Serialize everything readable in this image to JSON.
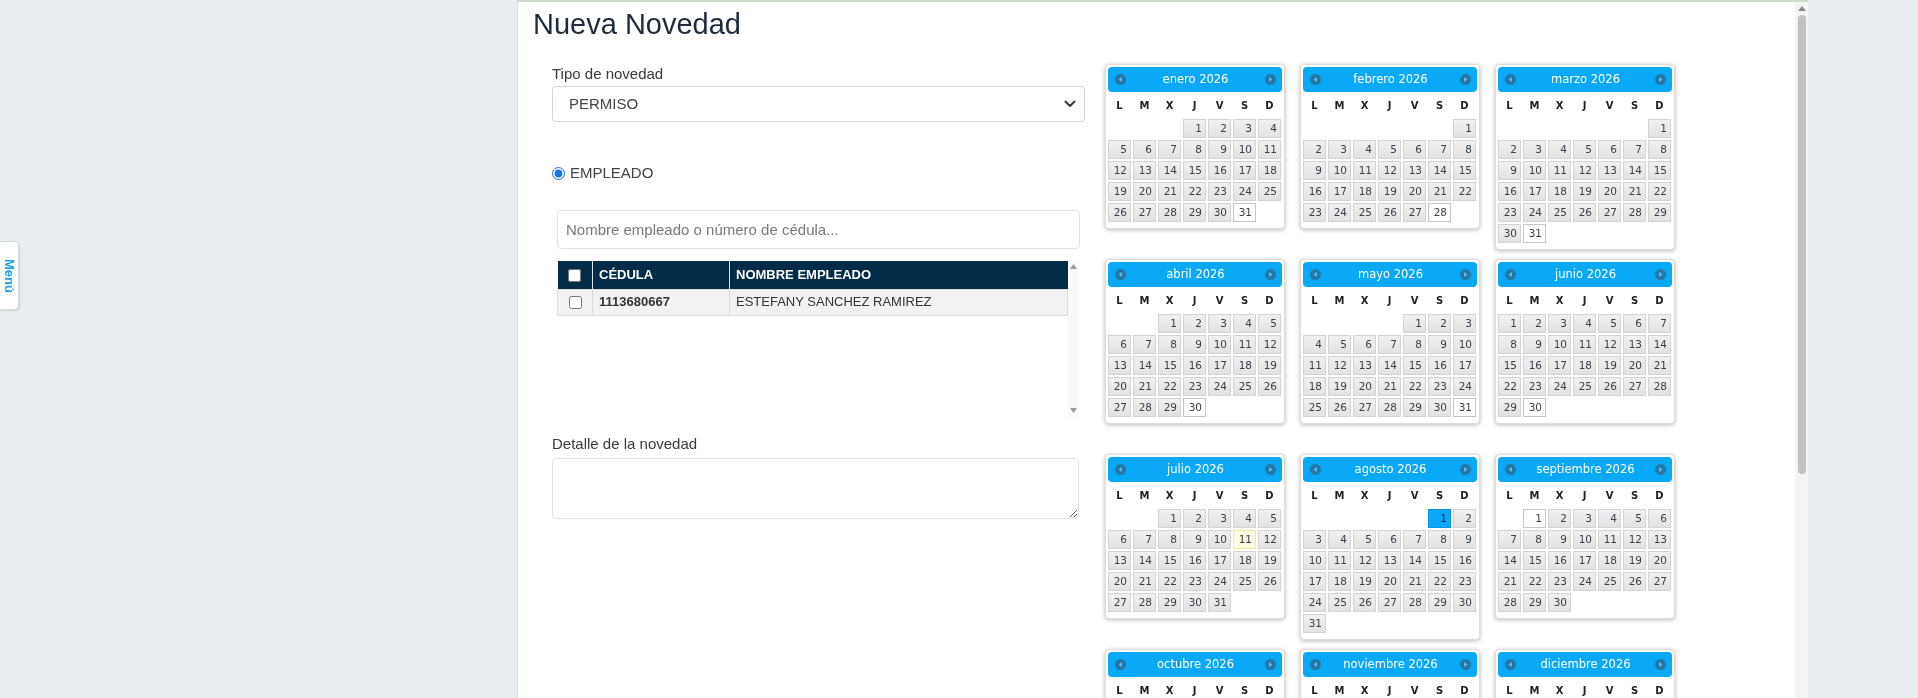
{
  "menu_tab": {
    "label": "Menú"
  },
  "title": "Nueva Novedad",
  "form": {
    "type_field": {
      "label": "Tipo de novedad",
      "value": "PERMISO"
    },
    "target_options": [
      {
        "label": "EMPLEADO",
        "selected": true
      }
    ],
    "search": {
      "placeholder": "Nombre empleado o número de cédula..."
    },
    "employee_table": {
      "select_all_checked": false,
      "columns": [
        "CÉDULA",
        "NOMBRE EMPLEADO"
      ],
      "rows": [
        {
          "checked": false,
          "cells": [
            "1113680667",
            "ESTEFANY SANCHEZ RAMIREZ"
          ]
        }
      ]
    },
    "detail_field": {
      "label": "Detalle de la novedad"
    }
  },
  "calendar": {
    "months": [
      {
        "title": "enero 2026",
        "weekdays": [
          "L",
          "M",
          "X",
          "J",
          "V",
          "S",
          "D"
        ],
        "weeks": [
          [
            {
              "day": "1",
              "selected": false,
              "kind": "plain"
            },
            {
              "day": "2",
              "selected": false,
              "kind": "plain"
            },
            {
              "day": "3",
              "selected": false,
              "kind": "plain"
            },
            {
              "day": "4",
              "selected": false,
              "kind": "plain"
            }
          ],
          [
            {
              "day": "5",
              "selected": false,
              "kind": "plain"
            },
            {
              "day": "6",
              "selected": false,
              "kind": "plain"
            },
            {
              "day": "7",
              "selected": false,
              "kind": "plain"
            },
            {
              "day": "8",
              "selected": false,
              "kind": "plain"
            },
            {
              "day": "9",
              "selected": false,
              "kind": "plain"
            },
            {
              "day": "10",
              "selected": false,
              "kind": "plain"
            },
            {
              "day": "11",
              "selected": false,
              "kind": "plain"
            }
          ],
          [
            {
              "day": "12",
              "selected": false,
              "kind": "plain"
            },
            {
              "day": "13",
              "selected": false,
              "kind": "plain"
            },
            {
              "day": "14",
              "selected": false,
              "kind": "plain"
            },
            {
              "day": "15",
              "selected": false,
              "kind": "plain"
            },
            {
              "day": "16",
              "selected": false,
              "kind": "plain"
            },
            {
              "day": "17",
              "selected": false,
              "kind": "plain"
            },
            {
              "day": "18",
              "selected": false,
              "kind": "plain"
            }
          ],
          [
            {
              "day": "19",
              "selected": false,
              "kind": "plain"
            },
            {
              "day": "20",
              "selected": false,
              "kind": "plain"
            },
            {
              "day": "21",
              "selected": false,
              "kind": "plain"
            },
            {
              "day": "22",
              "selected": false,
              "kind": "plain"
            },
            {
              "day": "23",
              "selected": false,
              "kind": "plain"
            },
            {
              "day": "24",
              "selected": false,
              "kind": "plain"
            },
            {
              "day": "25",
              "selected": false,
              "kind": "plain"
            }
          ],
          [
            {
              "day": "26",
              "selected": false,
              "kind": "plain"
            },
            {
              "day": "27",
              "selected": false,
              "kind": "plain"
            },
            {
              "day": "28",
              "selected": false,
              "kind": "plain"
            },
            {
              "day": "29",
              "selected": false,
              "kind": "plain"
            },
            {
              "day": "30",
              "selected": false,
              "kind": "plain"
            },
            {
              "day": "31",
              "selected": false,
              "kind": "outlined"
            }
          ]
        ]
      },
      {
        "title": "febrero 2026",
        "weekdays": [
          "L",
          "M",
          "X",
          "J",
          "V",
          "S",
          "D"
        ],
        "weeks": [
          [
            {
              "day": "1",
              "selected": false,
              "kind": "plain"
            }
          ],
          [
            {
              "day": "2",
              "selected": false,
              "kind": "plain"
            },
            {
              "day": "3",
              "selected": false,
              "kind": "plain"
            },
            {
              "day": "4",
              "selected": false,
              "kind": "plain"
            },
            {
              "day": "5",
              "selected": false,
              "kind": "plain"
            },
            {
              "day": "6",
              "selected": false,
              "kind": "plain"
            },
            {
              "day": "7",
              "selected": false,
              "kind": "plain"
            },
            {
              "day": "8",
              "selected": false,
              "kind": "plain"
            }
          ],
          [
            {
              "day": "9",
              "selected": false,
              "kind": "plain"
            },
            {
              "day": "10",
              "selected": false,
              "kind": "plain"
            },
            {
              "day": "11",
              "selected": false,
              "kind": "plain"
            },
            {
              "day": "12",
              "selected": false,
              "kind": "plain"
            },
            {
              "day": "13",
              "selected": false,
              "kind": "plain"
            },
            {
              "day": "14",
              "selected": false,
              "kind": "plain"
            },
            {
              "day": "15",
              "selected": false,
              "kind": "plain"
            }
          ],
          [
            {
              "day": "16",
              "selected": false,
              "kind": "plain"
            },
            {
              "day": "17",
              "selected": false,
              "kind": "plain"
            },
            {
              "day": "18",
              "selected": false,
              "kind": "plain"
            },
            {
              "day": "19",
              "selected": false,
              "kind": "plain"
            },
            {
              "day": "20",
              "selected": false,
              "kind": "plain"
            },
            {
              "day": "21",
              "selected": false,
              "kind": "plain"
            },
            {
              "day": "22",
              "selected": false,
              "kind": "plain"
            }
          ],
          [
            {
              "day": "23",
              "selected": false,
              "kind": "plain"
            },
            {
              "day": "24",
              "selected": false,
              "kind": "plain"
            },
            {
              "day": "25",
              "selected": false,
              "kind": "plain"
            },
            {
              "day": "26",
              "selected": false,
              "kind": "plain"
            },
            {
              "day": "27",
              "selected": false,
              "kind": "plain"
            },
            {
              "day": "28",
              "selected": false,
              "kind": "outlined"
            }
          ]
        ]
      },
      {
        "title": "marzo 2026",
        "weekdays": [
          "L",
          "M",
          "X",
          "J",
          "V",
          "S",
          "D"
        ],
        "weeks": [
          [
            {
              "day": "1",
              "selected": false,
              "kind": "plain"
            }
          ],
          [
            {
              "day": "2",
              "selected": false,
              "kind": "plain"
            },
            {
              "day": "3",
              "selected": false,
              "kind": "plain"
            },
            {
              "day": "4",
              "selected": false,
              "kind": "plain"
            },
            {
              "day": "5",
              "selected": false,
              "kind": "plain"
            },
            {
              "day": "6",
              "selected": false,
              "kind": "plain"
            },
            {
              "day": "7",
              "selected": false,
              "kind": "plain"
            },
            {
              "day": "8",
              "selected": false,
              "kind": "plain"
            }
          ],
          [
            {
              "day": "9",
              "selected": false,
              "kind": "plain"
            },
            {
              "day": "10",
              "selected": false,
              "kind": "plain"
            },
            {
              "day": "11",
              "selected": false,
              "kind": "plain"
            },
            {
              "day": "12",
              "selected": false,
              "kind": "plain"
            },
            {
              "day": "13",
              "selected": false,
              "kind": "plain"
            },
            {
              "day": "14",
              "selected": false,
              "kind": "plain"
            },
            {
              "day": "15",
              "selected": false,
              "kind": "plain"
            }
          ],
          [
            {
              "day": "16",
              "selected": false,
              "kind": "plain"
            },
            {
              "day": "17",
              "selected": false,
              "kind": "plain"
            },
            {
              "day": "18",
              "selected": false,
              "kind": "plain"
            },
            {
              "day": "19",
              "selected": false,
              "kind": "plain"
            },
            {
              "day": "20",
              "selected": false,
              "kind": "plain"
            },
            {
              "day": "21",
              "selected": false,
              "kind": "plain"
            },
            {
              "day": "22",
              "selected": false,
              "kind": "plain"
            }
          ],
          [
            {
              "day": "23",
              "selected": false,
              "kind": "plain"
            },
            {
              "day": "24",
              "selected": false,
              "kind": "plain"
            },
            {
              "day": "25",
              "selected": false,
              "kind": "plain"
            },
            {
              "day": "26",
              "selected": false,
              "kind": "plain"
            },
            {
              "day": "27",
              "selected": false,
              "kind": "plain"
            },
            {
              "day": "28",
              "selected": false,
              "kind": "plain"
            },
            {
              "day": "29",
              "selected": false,
              "kind": "plain"
            }
          ],
          [
            {
              "day": "30",
              "selected": false,
              "kind": "plain"
            },
            {
              "day": "31",
              "selected": false,
              "kind": "outlined"
            }
          ]
        ]
      },
      {
        "title": "abril 2026",
        "weekdays": [
          "L",
          "M",
          "X",
          "J",
          "V",
          "S",
          "D"
        ],
        "weeks": [
          [
            {
              "day": "1",
              "selected": false,
              "kind": "plain"
            },
            {
              "day": "2",
              "selected": false,
              "kind": "plain"
            },
            {
              "day": "3",
              "selected": false,
              "kind": "plain"
            },
            {
              "day": "4",
              "selected": false,
              "kind": "plain"
            },
            {
              "day": "5",
              "selected": false,
              "kind": "plain"
            }
          ],
          [
            {
              "day": "6",
              "selected": false,
              "kind": "plain"
            },
            {
              "day": "7",
              "selected": false,
              "kind": "plain"
            },
            {
              "day": "8",
              "selected": false,
              "kind": "plain"
            },
            {
              "day": "9",
              "selected": false,
              "kind": "plain"
            },
            {
              "day": "10",
              "selected": false,
              "kind": "plain"
            },
            {
              "day": "11",
              "selected": false,
              "kind": "plain"
            },
            {
              "day": "12",
              "selected": false,
              "kind": "plain"
            }
          ],
          [
            {
              "day": "13",
              "selected": false,
              "kind": "plain"
            },
            {
              "day": "14",
              "selected": false,
              "kind": "plain"
            },
            {
              "day": "15",
              "selected": false,
              "kind": "plain"
            },
            {
              "day": "16",
              "selected": false,
              "kind": "plain"
            },
            {
              "day": "17",
              "selected": false,
              "kind": "plain"
            },
            {
              "day": "18",
              "selected": false,
              "kind": "plain"
            },
            {
              "day": "19",
              "selected": false,
              "kind": "plain"
            }
          ],
          [
            {
              "day": "20",
              "selected": false,
              "kind": "plain"
            },
            {
              "day": "21",
              "selected": false,
              "kind": "plain"
            },
            {
              "day": "22",
              "selected": false,
              "kind": "plain"
            },
            {
              "day": "23",
              "selected": false,
              "kind": "plain"
            },
            {
              "day": "24",
              "selected": false,
              "kind": "plain"
            },
            {
              "day": "25",
              "selected": false,
              "kind": "plain"
            },
            {
              "day": "26",
              "selected": false,
              "kind": "plain"
            }
          ],
          [
            {
              "day": "27",
              "selected": false,
              "kind": "plain"
            },
            {
              "day": "28",
              "selected": false,
              "kind": "plain"
            },
            {
              "day": "29",
              "selected": false,
              "kind": "plain"
            },
            {
              "day": "30",
              "selected": false,
              "kind": "outlined"
            }
          ]
        ]
      },
      {
        "title": "mayo 2026",
        "weekdays": [
          "L",
          "M",
          "X",
          "J",
          "V",
          "S",
          "D"
        ],
        "weeks": [
          [
            {
              "day": "1",
              "selected": false,
              "kind": "plain"
            },
            {
              "day": "2",
              "selected": false,
              "kind": "plain"
            },
            {
              "day": "3",
              "selected": false,
              "kind": "plain"
            }
          ],
          [
            {
              "day": "4",
              "selected": false,
              "kind": "plain"
            },
            {
              "day": "5",
              "selected": false,
              "kind": "plain"
            },
            {
              "day": "6",
              "selected": false,
              "kind": "plain"
            },
            {
              "day": "7",
              "selected": false,
              "kind": "plain"
            },
            {
              "day": "8",
              "selected": false,
              "kind": "plain"
            },
            {
              "day": "9",
              "selected": false,
              "kind": "plain"
            },
            {
              "day": "10",
              "selected": false,
              "kind": "plain"
            }
          ],
          [
            {
              "day": "11",
              "selected": false,
              "kind": "plain"
            },
            {
              "day": "12",
              "selected": false,
              "kind": "plain"
            },
            {
              "day": "13",
              "selected": false,
              "kind": "plain"
            },
            {
              "day": "14",
              "selected": false,
              "kind": "plain"
            },
            {
              "day": "15",
              "selected": false,
              "kind": "plain"
            },
            {
              "day": "16",
              "selected": false,
              "kind": "plain"
            },
            {
              "day": "17",
              "selected": false,
              "kind": "plain"
            }
          ],
          [
            {
              "day": "18",
              "selected": false,
              "kind": "plain"
            },
            {
              "day": "19",
              "selected": false,
              "kind": "plain"
            },
            {
              "day": "20",
              "selected": false,
              "kind": "plain"
            },
            {
              "day": "21",
              "selected": false,
              "kind": "plain"
            },
            {
              "day": "22",
              "selected": false,
              "kind": "plain"
            },
            {
              "day": "23",
              "selected": false,
              "kind": "plain"
            },
            {
              "day": "24",
              "selected": false,
              "kind": "plain"
            }
          ],
          [
            {
              "day": "25",
              "selected": false,
              "kind": "plain"
            },
            {
              "day": "26",
              "selected": false,
              "kind": "plain"
            },
            {
              "day": "27",
              "selected": false,
              "kind": "plain"
            },
            {
              "day": "28",
              "selected": false,
              "kind": "plain"
            },
            {
              "day": "29",
              "selected": false,
              "kind": "plain"
            },
            {
              "day": "30",
              "selected": false,
              "kind": "plain"
            },
            {
              "day": "31",
              "selected": false,
              "kind": "outlined"
            }
          ]
        ]
      },
      {
        "title": "junio 2026",
        "weekdays": [
          "L",
          "M",
          "X",
          "J",
          "V",
          "S",
          "D"
        ],
        "weeks": [
          [
            {
              "day": "1",
              "selected": false,
              "kind": "plain"
            },
            {
              "day": "2",
              "selected": false,
              "kind": "plain"
            },
            {
              "day": "3",
              "selected": false,
              "kind": "plain"
            },
            {
              "day": "4",
              "selected": false,
              "kind": "plain"
            },
            {
              "day": "5",
              "selected": false,
              "kind": "plain"
            },
            {
              "day": "6",
              "selected": false,
              "kind": "plain"
            },
            {
              "day": "7",
              "selected": false,
              "kind": "plain"
            }
          ],
          [
            {
              "day": "8",
              "selected": false,
              "kind": "plain"
            },
            {
              "day": "9",
              "selected": false,
              "kind": "plain"
            },
            {
              "day": "10",
              "selected": false,
              "kind": "plain"
            },
            {
              "day": "11",
              "selected": false,
              "kind": "plain"
            },
            {
              "day": "12",
              "selected": false,
              "kind": "plain"
            },
            {
              "day": "13",
              "selected": false,
              "kind": "plain"
            },
            {
              "day": "14",
              "selected": false,
              "kind": "plain"
            }
          ],
          [
            {
              "day": "15",
              "selected": false,
              "kind": "plain"
            },
            {
              "day": "16",
              "selected": false,
              "kind": "plain"
            },
            {
              "day": "17",
              "selected": false,
              "kind": "plain"
            },
            {
              "day": "18",
              "selected": false,
              "kind": "plain"
            },
            {
              "day": "19",
              "selected": false,
              "kind": "plain"
            },
            {
              "day": "20",
              "selected": false,
              "kind": "plain"
            },
            {
              "day": "21",
              "selected": false,
              "kind": "plain"
            }
          ],
          [
            {
              "day": "22",
              "selected": false,
              "kind": "plain"
            },
            {
              "day": "23",
              "selected": false,
              "kind": "plain"
            },
            {
              "day": "24",
              "selected": false,
              "kind": "plain"
            },
            {
              "day": "25",
              "selected": false,
              "kind": "plain"
            },
            {
              "day": "26",
              "selected": false,
              "kind": "plain"
            },
            {
              "day": "27",
              "selected": false,
              "kind": "plain"
            },
            {
              "day": "28",
              "selected": false,
              "kind": "plain"
            }
          ],
          [
            {
              "day": "29",
              "selected": false,
              "kind": "plain"
            },
            {
              "day": "30",
              "selected": false,
              "kind": "outlined"
            }
          ]
        ]
      },
      {
        "title": "julio 2026",
        "weekdays": [
          "L",
          "M",
          "X",
          "J",
          "V",
          "S",
          "D"
        ],
        "weeks": [
          [
            {
              "day": "1",
              "selected": false,
              "kind": "plain"
            },
            {
              "day": "2",
              "selected": false,
              "kind": "plain"
            },
            {
              "day": "3",
              "selected": false,
              "kind": "plain"
            },
            {
              "day": "4",
              "selected": false,
              "kind": "plain"
            },
            {
              "day": "5",
              "selected": false,
              "kind": "plain"
            }
          ],
          [
            {
              "day": "6",
              "selected": false,
              "kind": "plain"
            },
            {
              "day": "7",
              "selected": false,
              "kind": "plain"
            },
            {
              "day": "8",
              "selected": false,
              "kind": "plain"
            },
            {
              "day": "9",
              "selected": false,
              "kind": "plain"
            },
            {
              "day": "10",
              "selected": false,
              "kind": "plain"
            },
            {
              "day": "11",
              "selected": false,
              "kind": "today"
            },
            {
              "day": "12",
              "selected": false,
              "kind": "plain"
            }
          ],
          [
            {
              "day": "13",
              "selected": false,
              "kind": "plain"
            },
            {
              "day": "14",
              "selected": false,
              "kind": "plain"
            },
            {
              "day": "15",
              "selected": false,
              "kind": "plain"
            },
            {
              "day": "16",
              "selected": false,
              "kind": "plain"
            },
            {
              "day": "17",
              "selected": false,
              "kind": "plain"
            },
            {
              "day": "18",
              "selected": false,
              "kind": "plain"
            },
            {
              "day": "19",
              "selected": false,
              "kind": "plain"
            }
          ],
          [
            {
              "day": "20",
              "selected": false,
              "kind": "plain"
            },
            {
              "day": "21",
              "selected": false,
              "kind": "plain"
            },
            {
              "day": "22",
              "selected": false,
              "kind": "plain"
            },
            {
              "day": "23",
              "selected": false,
              "kind": "plain"
            },
            {
              "day": "24",
              "selected": false,
              "kind": "plain"
            },
            {
              "day": "25",
              "selected": false,
              "kind": "plain"
            },
            {
              "day": "26",
              "selected": false,
              "kind": "plain"
            }
          ],
          [
            {
              "day": "27",
              "selected": false,
              "kind": "plain"
            },
            {
              "day": "28",
              "selected": false,
              "kind": "plain"
            },
            {
              "day": "29",
              "selected": false,
              "kind": "plain"
            },
            {
              "day": "30",
              "selected": false,
              "kind": "plain"
            },
            {
              "day": "31",
              "selected": false,
              "kind": "plain"
            }
          ]
        ]
      },
      {
        "title": "agosto 2026",
        "weekdays": [
          "L",
          "M",
          "X",
          "J",
          "V",
          "S",
          "D"
        ],
        "weeks": [
          [
            {
              "day": "1",
              "selected": true,
              "kind": "plain"
            },
            {
              "day": "2",
              "selected": false,
              "kind": "plain"
            }
          ],
          [
            {
              "day": "3",
              "selected": false,
              "kind": "plain"
            },
            {
              "day": "4",
              "selected": false,
              "kind": "plain"
            },
            {
              "day": "5",
              "selected": false,
              "kind": "plain"
            },
            {
              "day": "6",
              "selected": false,
              "kind": "plain"
            },
            {
              "day": "7",
              "selected": false,
              "kind": "plain"
            },
            {
              "day": "8",
              "selected": false,
              "kind": "plain"
            },
            {
              "day": "9",
              "selected": false,
              "kind": "plain"
            }
          ],
          [
            {
              "day": "10",
              "selected": false,
              "kind": "plain"
            },
            {
              "day": "11",
              "selected": false,
              "kind": "plain"
            },
            {
              "day": "12",
              "selected": false,
              "kind": "plain"
            },
            {
              "day": "13",
              "selected": false,
              "kind": "plain"
            },
            {
              "day": "14",
              "selected": false,
              "kind": "plain"
            },
            {
              "day": "15",
              "selected": false,
              "kind": "plain"
            },
            {
              "day": "16",
              "selected": false,
              "kind": "plain"
            }
          ],
          [
            {
              "day": "17",
              "selected": false,
              "kind": "plain"
            },
            {
              "day": "18",
              "selected": false,
              "kind": "plain"
            },
            {
              "day": "19",
              "selected": false,
              "kind": "plain"
            },
            {
              "day": "20",
              "selected": false,
              "kind": "plain"
            },
            {
              "day": "21",
              "selected": false,
              "kind": "plain"
            },
            {
              "day": "22",
              "selected": false,
              "kind": "plain"
            },
            {
              "day": "23",
              "selected": false,
              "kind": "plain"
            }
          ],
          [
            {
              "day": "24",
              "selected": false,
              "kind": "plain"
            },
            {
              "day": "25",
              "selected": false,
              "kind": "plain"
            },
            {
              "day": "26",
              "selected": false,
              "kind": "plain"
            },
            {
              "day": "27",
              "selected": false,
              "kind": "plain"
            },
            {
              "day": "28",
              "selected": false,
              "kind": "plain"
            },
            {
              "day": "29",
              "selected": false,
              "kind": "plain"
            },
            {
              "day": "30",
              "selected": false,
              "kind": "plain"
            }
          ],
          [
            {
              "day": "31",
              "selected": false,
              "kind": "plain"
            }
          ]
        ]
      },
      {
        "title": "septiembre 2026",
        "weekdays": [
          "L",
          "M",
          "X",
          "J",
          "V",
          "S",
          "D"
        ],
        "weeks": [
          [
            {
              "day": "1",
              "selected": false,
              "kind": "outlined"
            },
            {
              "day": "2",
              "selected": false,
              "kind": "plain"
            },
            {
              "day": "3",
              "selected": false,
              "kind": "plain"
            },
            {
              "day": "4",
              "selected": false,
              "kind": "plain"
            },
            {
              "day": "5",
              "selected": false,
              "kind": "plain"
            },
            {
              "day": "6",
              "selected": false,
              "kind": "plain"
            }
          ],
          [
            {
              "day": "7",
              "selected": false,
              "kind": "plain"
            },
            {
              "day": "8",
              "selected": false,
              "kind": "plain"
            },
            {
              "day": "9",
              "selected": false,
              "kind": "plain"
            },
            {
              "day": "10",
              "selected": false,
              "kind": "plain"
            },
            {
              "day": "11",
              "selected": false,
              "kind": "plain"
            },
            {
              "day": "12",
              "selected": false,
              "kind": "plain"
            },
            {
              "day": "13",
              "selected": false,
              "kind": "plain"
            }
          ],
          [
            {
              "day": "14",
              "selected": false,
              "kind": "plain"
            },
            {
              "day": "15",
              "selected": false,
              "kind": "plain"
            },
            {
              "day": "16",
              "selected": false,
              "kind": "plain"
            },
            {
              "day": "17",
              "selected": false,
              "kind": "plain"
            },
            {
              "day": "18",
              "selected": false,
              "kind": "plain"
            },
            {
              "day": "19",
              "selected": false,
              "kind": "plain"
            },
            {
              "day": "20",
              "selected": false,
              "kind": "plain"
            }
          ],
          [
            {
              "day": "21",
              "selected": false,
              "kind": "plain"
            },
            {
              "day": "22",
              "selected": false,
              "kind": "plain"
            },
            {
              "day": "23",
              "selected": false,
              "kind": "plain"
            },
            {
              "day": "24",
              "selected": false,
              "kind": "plain"
            },
            {
              "day": "25",
              "selected": false,
              "kind": "plain"
            },
            {
              "day": "26",
              "selected": false,
              "kind": "plain"
            },
            {
              "day": "27",
              "selected": false,
              "kind": "plain"
            }
          ],
          [
            {
              "day": "28",
              "selected": false,
              "kind": "plain"
            },
            {
              "day": "29",
              "selected": false,
              "kind": "plain"
            },
            {
              "day": "30",
              "selected": false,
              "kind": "plain"
            }
          ]
        ]
      },
      {
        "title": "octubre 2026",
        "weekdays": [
          "L",
          "M",
          "X",
          "J",
          "V",
          "S",
          "D"
        ]
      },
      {
        "title": "noviembre 2026",
        "weekdays": [
          "L",
          "M",
          "X",
          "J",
          "V",
          "S",
          "D"
        ]
      },
      {
        "title": "diciembre 2026",
        "weekdays": [
          "L",
          "M",
          "X",
          "J",
          "V",
          "S",
          "D"
        ]
      }
    ]
  }
}
